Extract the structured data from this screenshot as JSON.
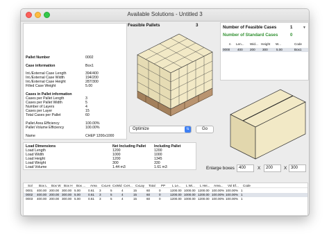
{
  "window": {
    "title": "Available Solutions - Untitled 3"
  },
  "info": {
    "pallet_number_label": "Pallet Number",
    "pallet_number": "0002",
    "case_info_label": "Case information",
    "case_info": "Box1",
    "ext_len_label": "Int./External Case Length",
    "ext_len": "394/400",
    "ext_wid_label": "Int./External Case Width",
    "ext_wid": "194/200",
    "ext_hei_label": "Int./External Case Height",
    "ext_hei": "287/300",
    "filled_label": "Filled Case Weight",
    "filled": "5.00",
    "cases_label": "Cases in Pallet information",
    "len_label": "Cases per Pallet Length",
    "len": "3",
    "wid_label": "Cases per Pallet Width",
    "wid": "5",
    "layers_label": "Number of Layers",
    "layers": "4",
    "per_layer_label": "Cases per Layer",
    "per_layer": "15",
    "total_label": "Total Cases per Pallet",
    "total": "60",
    "area_eff_label": "Pallet Area Efficiency",
    "area_eff": "100.00%",
    "vol_eff_label": "Pallet Volume Efficiency",
    "vol_eff": "100.00%",
    "name_label": "Name",
    "name": "CHEP 1200x1000"
  },
  "pallet_view": {
    "label": "Feasible Pallets",
    "count": "3"
  },
  "controls": {
    "optimize": "Optimize",
    "go": "Go",
    "enlarge_label": "Enlarge boxes",
    "x_sep": "X",
    "enl1": "400",
    "enl2": "200",
    "enl3": "300"
  },
  "summary": {
    "feasible_label": "Number of Feasible Cases",
    "feasible": "1",
    "standard_label": "Number of Standard Cases",
    "standard": "0",
    "headers": [
      "n",
      "Len...",
      "Wid...",
      "Height",
      "W...",
      "Code"
    ],
    "row": [
      "0000",
      "400",
      "200",
      "300",
      "5.00",
      "Box1"
    ]
  },
  "load": {
    "h1": "Load Dimensions",
    "h2": "Net Including Pallet",
    "h3": "Including Pallet",
    "rows": [
      [
        "Load Length",
        "1200",
        "1200"
      ],
      [
        "Load Width",
        "1000",
        "1000"
      ],
      [
        "Load Height",
        "1200",
        "1345"
      ],
      [
        "Load Weight",
        "300",
        "330"
      ],
      [
        "Load Volume",
        "1.44 m3",
        "1.61 m3"
      ]
    ]
  },
  "results": {
    "headers": [
      "Sol",
      "Box L",
      "Box W",
      "Box H",
      "Box ...",
      "Area",
      "CxLen",
      "CxWid",
      "CxH...",
      "CxLay",
      "Total",
      "PP",
      "L Le...",
      "L Wi...",
      "L Hei...",
      "Area...",
      "Vol Ef...",
      "Code"
    ],
    "rows": [
      [
        "0001",
        "400.00",
        "200.00",
        "300.00",
        "5.00",
        "0.61",
        "3",
        "5",
        "4",
        "15",
        "60",
        "0",
        "1200.00",
        "1000.00",
        "1200.00",
        "100.00%",
        "100.00%",
        "1"
      ],
      [
        "0002",
        "400.00",
        "200.00",
        "300.00",
        "5.00",
        "0.61",
        "3",
        "5",
        "4",
        "15",
        "60",
        "0",
        "1200.00",
        "1000.00",
        "1200.00",
        "100.00%",
        "100.00%",
        "1"
      ],
      [
        "0003",
        "400.00",
        "200.00",
        "300.00",
        "5.00",
        "0.61",
        "3",
        "5",
        "4",
        "15",
        "60",
        "0",
        "1200.00",
        "1000.00",
        "1200.00",
        "100.00%",
        "100.00%",
        "1"
      ]
    ]
  },
  "colors": {
    "box_face": "#f2e9c6",
    "box_side": "#e2d7ad",
    "pallet_wood": "#b08c67",
    "accent": "#3d7ff4"
  }
}
